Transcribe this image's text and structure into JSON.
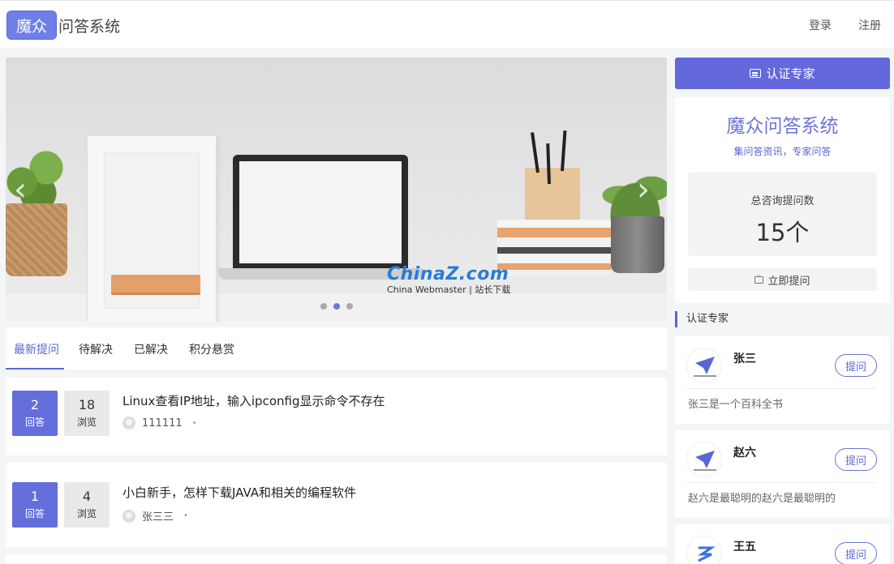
{
  "header": {
    "logo_badge": "魔众",
    "logo_text": "问答系统",
    "login": "登录",
    "register": "注册"
  },
  "banner": {
    "slides": 3,
    "active_slide": 2,
    "prev_icon": "chevron-left-icon",
    "next_icon": "chevron-right-icon",
    "watermark_main": "ChinaZ.com",
    "watermark_sub": "China Webmaster | 站长下载"
  },
  "tabs": [
    {
      "label": "最新提问",
      "active": true
    },
    {
      "label": "待解决",
      "active": false
    },
    {
      "label": "已解决",
      "active": false
    },
    {
      "label": "积分悬赏",
      "active": false
    }
  ],
  "questions": [
    {
      "answers": "2",
      "answers_label": "回答",
      "views": "18",
      "views_label": "浏览",
      "title": "Linux查看IP地址，输入ipconfig显示命令不存在",
      "user": "111111"
    },
    {
      "answers": "1",
      "answers_label": "回答",
      "views": "4",
      "views_label": "浏览",
      "title": "小白新手，怎样下载JAVA和相关的编程软件",
      "user": "张三三"
    }
  ],
  "sidebar": {
    "verify_button": "认证专家",
    "info_title": "魔众问答系统",
    "info_subtitle": "集问答资讯，专家问答",
    "count_label": "总咨询提问数",
    "count_value": "15个",
    "ask_button": "立即提问",
    "experts_heading": "认证专家",
    "experts": [
      {
        "name": "张三",
        "ask_label": "提问",
        "desc": "张三是一个百科全书"
      },
      {
        "name": "赵六",
        "ask_label": "提问",
        "desc": "赵六是最聪明的赵六是最聪明的"
      },
      {
        "name": "王五",
        "ask_label": "提问",
        "desc": ""
      }
    ]
  },
  "colors": {
    "accent": "#6468dd",
    "accent_text": "#5b66d6",
    "view_bg": "#e9e9ec"
  }
}
